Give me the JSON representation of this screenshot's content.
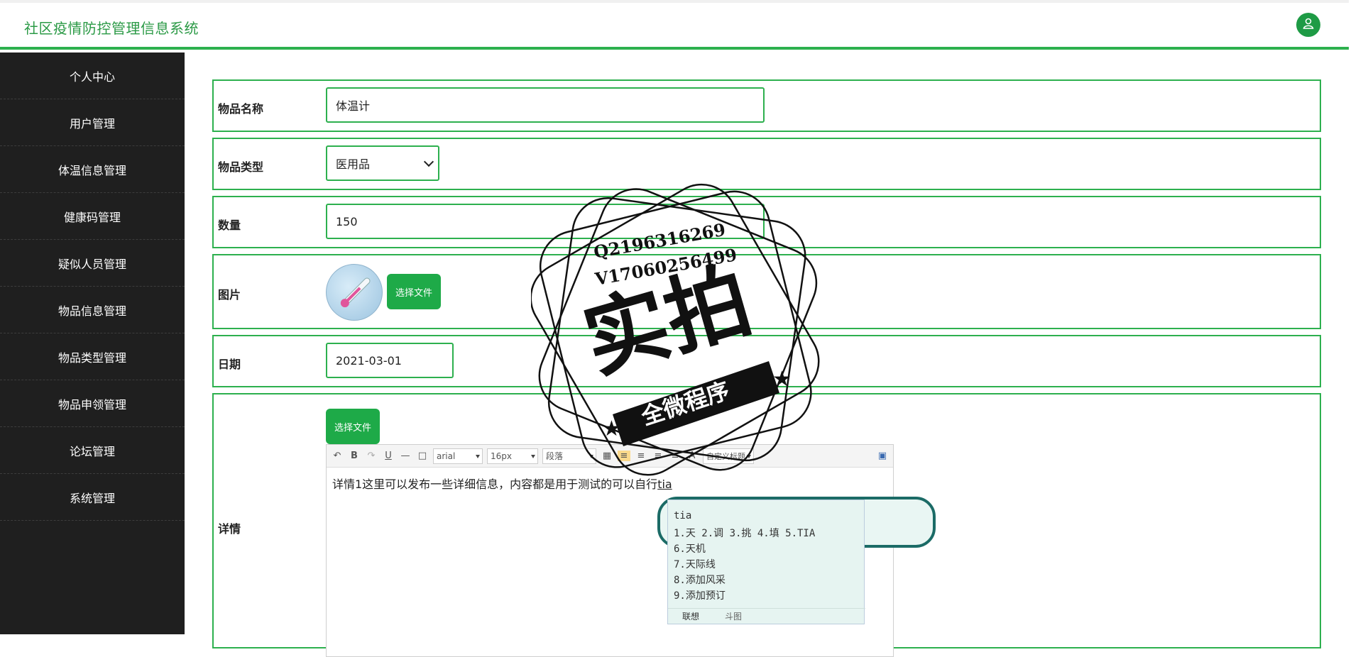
{
  "app": {
    "title": "社区疫情防控管理信息系统"
  },
  "sidebar": {
    "items": [
      {
        "label": "个人中心"
      },
      {
        "label": "用户管理"
      },
      {
        "label": "体温信息管理"
      },
      {
        "label": "健康码管理"
      },
      {
        "label": "疑似人员管理"
      },
      {
        "label": "物品信息管理"
      },
      {
        "label": "物品类型管理"
      },
      {
        "label": "物品申领管理"
      },
      {
        "label": "论坛管理"
      },
      {
        "label": "系统管理"
      }
    ]
  },
  "form": {
    "name": {
      "label": "物品名称",
      "value": "体温计"
    },
    "type": {
      "label": "物品类型",
      "value": "医用品"
    },
    "quantity": {
      "label": "数量",
      "value": "150"
    },
    "image": {
      "label": "图片",
      "button": "选择文件"
    },
    "date": {
      "label": "日期",
      "value": "2021-03-01"
    },
    "detail": {
      "label": "详情",
      "button": "选择文件",
      "text_before": "详情1这里可以发布一些详细信息，内容都是用于测试的可以自行",
      "text_typed": "tia"
    }
  },
  "editor_toolbar": {
    "font": "arial",
    "size": "16px",
    "paragraph": "段落",
    "custom": "自定义标题"
  },
  "ime": {
    "input": "tia",
    "candidates_row1": "1.天 2.调 3.挑 4.填 5.TIA",
    "candidates": [
      "6.天机",
      "7.天际线",
      "8.添加风采",
      "9.添加预订"
    ],
    "tabs": [
      "联想",
      "斗图"
    ]
  },
  "watermark": {
    "contact1": "Q2196316269",
    "contact2": "V17060256499",
    "main": "实拍",
    "banner": "全微程序"
  },
  "colors": {
    "accent": "#2db04e",
    "sidebar": "#1f1f1f",
    "button": "#1eaa48"
  }
}
